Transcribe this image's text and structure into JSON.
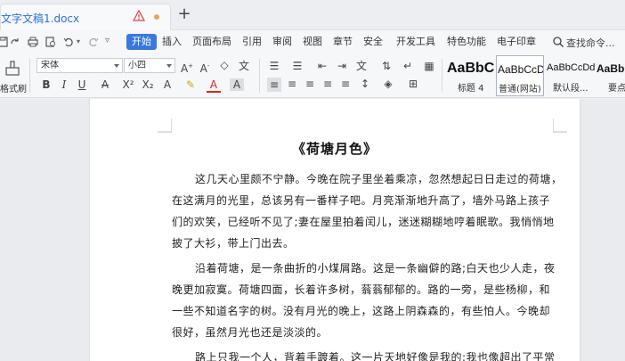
{
  "tabs": {
    "document_title": "文字文稿1.docx"
  },
  "menu": {
    "items": [
      {
        "label": "开始",
        "active": true
      },
      {
        "label": "插入"
      },
      {
        "label": "页面布局"
      },
      {
        "label": "引用"
      },
      {
        "label": "审阅"
      },
      {
        "label": "视图"
      },
      {
        "label": "章节"
      },
      {
        "label": "安全"
      },
      {
        "label": "开发工具"
      },
      {
        "label": "特色功能"
      },
      {
        "label": "电子印章"
      }
    ],
    "search_label": "查找命令..."
  },
  "ribbon": {
    "format_painter_label": "格式刷",
    "font_family": "宋体",
    "font_size": "小四",
    "styles": [
      {
        "sample": "AaBbC",
        "name": "标题 4"
      },
      {
        "sample": "AaBbCcDd",
        "name": "普通(网站)",
        "selected": true
      },
      {
        "sample": "AaBbCcDd",
        "name": "默认段..."
      },
      {
        "sample": "AaBbC",
        "name": "要点"
      }
    ]
  },
  "document": {
    "title": "《荷塘月色》",
    "lines": [
      "这几天心里颇不宁静。今晚在院子里坐着乘凉，忽然想起日日走过的荷塘，",
      "在这满月的光里，总该另有一番样子吧。月亮渐渐地升高了，墙外马路上孩子",
      "们的欢笑，已经听不见了;妻在屋里拍着闰儿，迷迷糊糊地哼着眠歌。我悄悄地",
      "披了大衫，带上门出去。",
      "沿着荷塘，是一条曲折的小煤屑路。这是一条幽僻的路;白天也少人走，夜",
      "晚更加寂寞。荷塘四面，长着许多树，蓊蓊郁郁的。路的一旁，是些杨柳，和",
      "一些不知道名字的树。没有月光的晚上，这路上阴森森的，有些怕人。今晚却",
      "很好，虽然月光也还是淡淡的。",
      "路上只我一个人，背着手踱着。这一片天地好像是我的;我也像超出了平常"
    ]
  },
  "colors": {
    "accent": "#3a78e0",
    "tab_title": "#2b6fd6"
  }
}
